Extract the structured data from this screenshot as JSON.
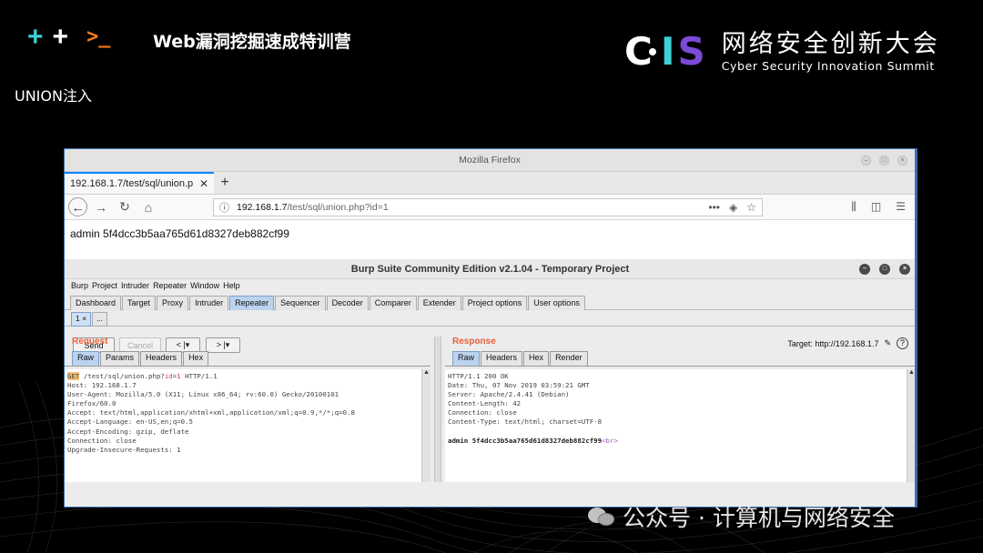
{
  "slide": {
    "plus_1": "+",
    "plus_2": "+",
    "prompt": ">_",
    "title": "Web漏洞挖掘速成特训营",
    "section": "UNION注入",
    "brand_cn": "网络安全创新大会",
    "brand_en": "Cyber Security Innovation Summit",
    "brand_letters": {
      "c": "C",
      "i": "I",
      "s": "S"
    },
    "watermark": "公众号 · 计算机与网络安全"
  },
  "firefox": {
    "window_title": "Mozilla Firefox",
    "tab_label": "192.168.1.7/test/sql/union.p",
    "url_host": "192.168.1.7",
    "url_path": "/test/sql/union.php?id=1",
    "page_text": "admin 5f4dcc3b5aa765d61d8327deb882cf99"
  },
  "burp": {
    "window_title": "Burp Suite Community Edition v2.1.04 - Temporary Project",
    "menu": [
      "Burp",
      "Project",
      "Intruder",
      "Repeater",
      "Window",
      "Help"
    ],
    "tabs": [
      "Dashboard",
      "Target",
      "Proxy",
      "Intruder",
      "Repeater",
      "Sequencer",
      "Decoder",
      "Comparer",
      "Extender",
      "Project options",
      "User options"
    ],
    "active_tab": "Repeater",
    "sub_tabs": [
      "1 ×",
      "..."
    ],
    "send_label": "Send",
    "cancel_label": "Cancel",
    "back_label": "< |▾",
    "fwd_label": "> |▾",
    "target_label": "Target: http://192.168.1.7",
    "request": {
      "title": "Request",
      "tabs": [
        "Raw",
        "Params",
        "Headers",
        "Hex"
      ],
      "first_line": {
        "method": "GET",
        "path": "/test/sql/union.php?",
        "param": "id",
        "eq": "=",
        "value": "1",
        "proto": " HTTP/1.1"
      },
      "lines": [
        "Host: 192.168.1.7",
        "User-Agent: Mozilla/5.0 (X11; Linux x86_64; rv:60.0) Gecko/20100101",
        "Firefox/60.0",
        "Accept: text/html,application/xhtml+xml,application/xml;q=0.9,*/*;q=0.8",
        "Accept-Language: en-US,en;q=0.5",
        "Accept-Encoding: gzip, deflate",
        "Connection: close",
        "Upgrade-Insecure-Requests: 1"
      ]
    },
    "response": {
      "title": "Response",
      "tabs": [
        "Raw",
        "Headers",
        "Hex",
        "Render"
      ],
      "lines": [
        "HTTP/1.1 200 OK",
        "Date: Thu, 07 Nov 2019 03:59:21 GMT",
        "Server: Apache/2.4.41 (Debian)",
        "Content-Length: 42",
        "Connection: close",
        "Content-Type: text/html; charset=UTF-8"
      ],
      "body": "admin 5f4dcc3b5aa765d61d8327deb882cf99",
      "body_tag": "<br>"
    }
  }
}
